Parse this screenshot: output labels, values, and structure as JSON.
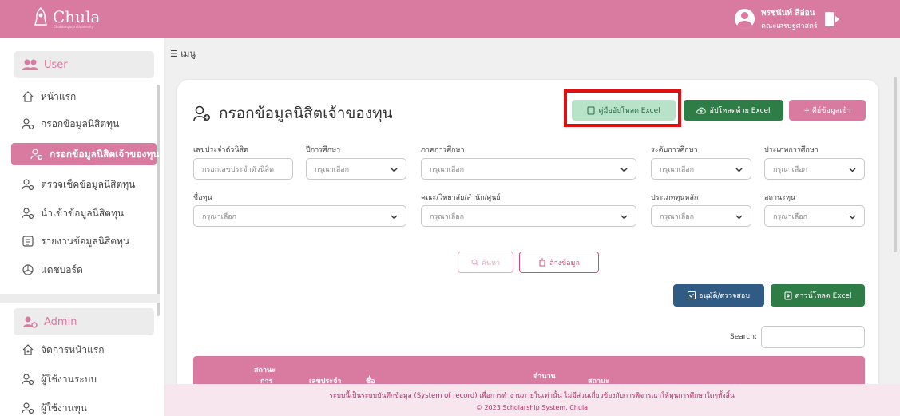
{
  "header": {
    "logo_text": "Chula",
    "logo_sub": "Chulalongkorn University",
    "user_name": "พรชนันท์ สีอ่อน",
    "user_faculty": "คณะเศรษฐศาสตร์"
  },
  "sidebar": {
    "user_header": "User",
    "user_items": [
      "หน้าแรก",
      "กรอกข้อมูลนิสิตทุน",
      "กรอกข้อมูลนิสิตเจ้าของทุน",
      "ตรวจเช็คข้อมูลนิสิตทุน",
      "นำเข้าข้อมูลนิสิตทุน",
      "รายงานข้อมูลนิสิตทุน",
      "แดชบอร์ด"
    ],
    "admin_header": "Admin",
    "admin_items": [
      "จัดการหน้าแรก",
      "ผู้ใช้งานระบบ",
      "ผู้ใช้งานทุน"
    ]
  },
  "main": {
    "menu_label": "เมนู",
    "title": "กรอกข้อมูลนิสิตเจ้าของทุน",
    "buttons": {
      "manual": "คู่มืออัปโหลด Excel",
      "upload": "อัปโหลดด้วย Excel",
      "add": "+ คีย์ข้อมูลเข้า",
      "search": "ค้นหา",
      "clear": "ล้างข้อมูล",
      "approve": "อนุมัติ/ตรวจสอบ",
      "download": "ดาวน์โหลด Excel"
    },
    "filters": {
      "student_id_label": "เลขประจำตัวนิสิต",
      "student_id_placeholder": "กรอกเลขประจำตัวนิสิต",
      "year_label": "ปีการศึกษา",
      "term_label": "ภาคการศึกษา",
      "level_label": "ระดับการศึกษา",
      "program_label": "ประเภทการศึกษา",
      "scholarship_label": "ชื่อทุน",
      "faculty_label": "คณะ/วิทยาลัย/สำนัก/ศูนย์",
      "main_type_label": "ประเภททุนหลัก",
      "status_label": "สถานะทุน",
      "select_placeholder": "กรุณาเลือก"
    },
    "search_label": "Search:",
    "table_headers": [
      "สถานะ",
      "การ",
      "เลขประจำ",
      "ชื่อ",
      "จำนวน",
      "สถานะ"
    ]
  },
  "footer": {
    "notice": "ระบบนี้เป็นระบบบันทึกข้อมูล (System of record) เพื่อการทำงานภายในเท่านั้น ไม่มีส่วนเกี่ยวข้องกับการพิจารณาให้ทุนการศึกษาใดๆทั้งสิ้น",
    "copyright": "© 2023 Scholarship System, Chula"
  },
  "colors": {
    "brand_pink": "#d97aa0",
    "green": "#2e7d46",
    "navy": "#2f5b85",
    "highlight_red": "#e01010"
  },
  "icons": [
    "user-icon",
    "logout-icon",
    "home-icon",
    "person-add-icon",
    "list-icon",
    "dashboard-icon",
    "settings-icon",
    "file-icon",
    "upload-cloud-icon",
    "search-icon",
    "trash-icon",
    "check-icon",
    "download-icon",
    "chevron-down-icon"
  ]
}
